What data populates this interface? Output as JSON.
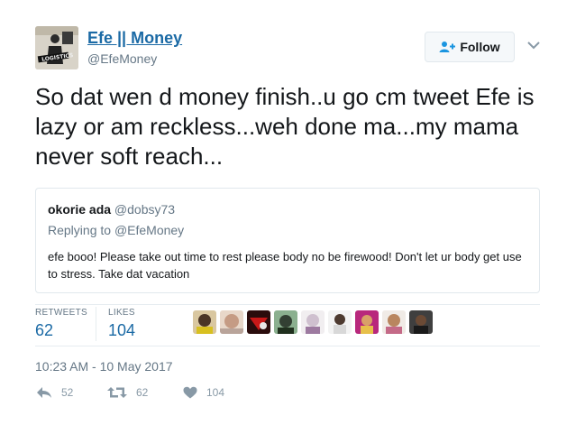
{
  "author": {
    "name": "Efe || Money",
    "handle": "@EfeMoney",
    "avatar_text": "LOGISTICS"
  },
  "follow_button": {
    "label": "Follow"
  },
  "tweet": {
    "text": "So dat wen d money finish..u go cm tweet Efe is lazy or am reckless...weh done ma...my mama never soft reach..."
  },
  "quoted": {
    "name": "okorie ada",
    "handle": "@dobsy73",
    "replying_label": "Replying to",
    "replying_to": "@EfeMoney",
    "text": "efe booo! Please take out time to rest please body no be firewood! Don't let ur body get use to stress. Take dat vacation"
  },
  "stats": {
    "retweets_label": "RETWEETS",
    "retweets": "62",
    "likes_label": "LIKES",
    "likes": "104"
  },
  "likers_count_shown": 9,
  "timestamp": "10:23 AM - 10 May 2017",
  "actions": {
    "reply_count": "52",
    "retweet_count": "62",
    "like_count": "104"
  },
  "colors": {
    "link": "#1b6aa5",
    "muted": "#657786",
    "action": "#8899a6",
    "border": "#e1e8ed"
  }
}
